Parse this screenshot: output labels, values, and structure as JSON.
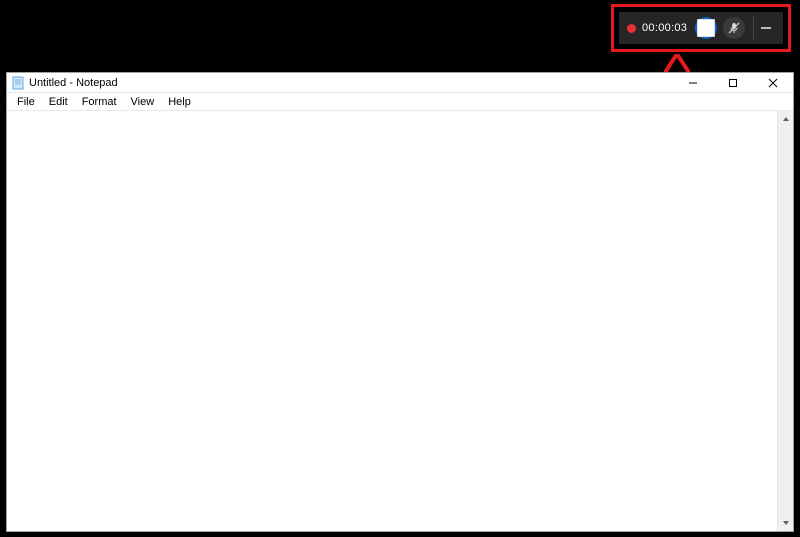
{
  "recording": {
    "timer": "00:00:03"
  },
  "notepad": {
    "title": "Untitled - Notepad",
    "menu": {
      "file": "File",
      "edit": "Edit",
      "format": "Format",
      "view": "View",
      "help": "Help"
    },
    "editor_value": ""
  },
  "annotation": {
    "highlight_color": "#e6181a"
  }
}
